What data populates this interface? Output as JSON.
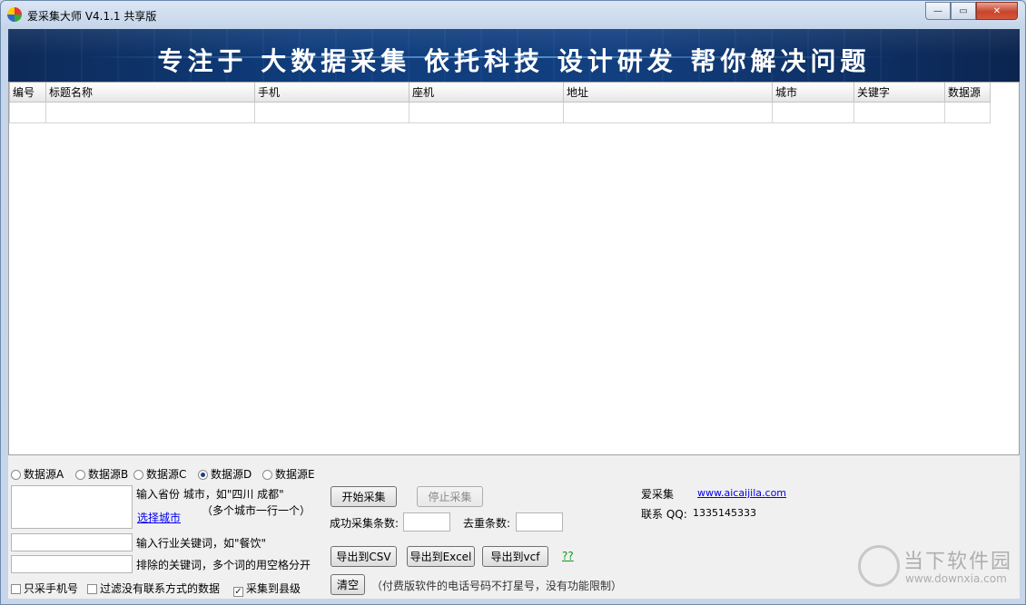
{
  "window": {
    "title": "爱采集大师 V4.1.1 共享版",
    "min": "—",
    "max": "▭",
    "close": "✕"
  },
  "banner": {
    "text": "专注于 大数据采集 依托科技 设计研发 帮你解决问题"
  },
  "table": {
    "columns": [
      "编号",
      "标题名称",
      "手机",
      "座机",
      "地址",
      "城市",
      "关键字",
      "数据源"
    ]
  },
  "sources": [
    {
      "label": "数据源A",
      "checked": false
    },
    {
      "label": "数据源B",
      "checked": false
    },
    {
      "label": "数据源C",
      "checked": false
    },
    {
      "label": "数据源D",
      "checked": true
    },
    {
      "label": "数据源E",
      "checked": false
    }
  ],
  "city": {
    "hint": "输入省份 城市，如\"四川 成都\"",
    "hint2": "（多个城市一行一个）",
    "select_link": "选择城市"
  },
  "keyword": {
    "hint": "输入行业关键词，如\"餐饮\""
  },
  "exclude": {
    "hint": "排除的关键词，多个词的用空格分开"
  },
  "options": [
    {
      "label": "只采手机号",
      "checked": false
    },
    {
      "label": "过滤没有联系方式的数据",
      "checked": false
    },
    {
      "label": "采集到县级",
      "checked": true
    }
  ],
  "buttons": {
    "start": "开始采集",
    "stop": "停止采集",
    "export_csv": "导出到CSV",
    "export_excel": "导出到Excel",
    "export_vcf": "导出到vcf",
    "help": "??",
    "clear": "清空"
  },
  "stats": {
    "success_label": "成功采集条数:",
    "dedup_label": "去重条数:"
  },
  "note": "（付费版软件的电话号码不打星号，没有功能限制）",
  "contact": {
    "brand": "爱采集",
    "url": "www.aicaijila.com",
    "qq_label": "联系 QQ:",
    "qq": "1335145333"
  },
  "watermark": {
    "name": "当下软件园",
    "url": "www.downxia.com"
  }
}
